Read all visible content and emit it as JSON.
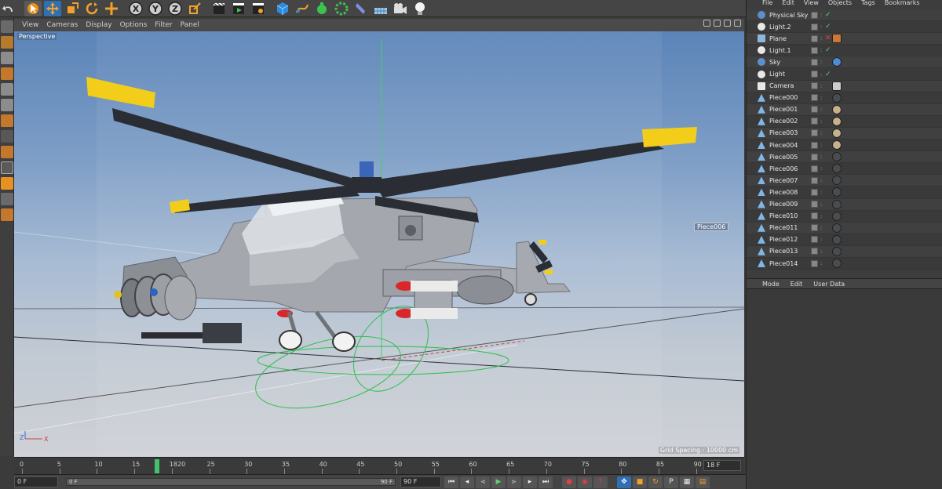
{
  "toolbar": {
    "axis_x": "X",
    "axis_y": "Y",
    "axis_z": "Z"
  },
  "viewport": {
    "menu": [
      "View",
      "Cameras",
      "Display",
      "Options",
      "Filter",
      "Panel"
    ],
    "camera_label": "Perspective",
    "selected_tag": "Piece006",
    "grid_spacing": "Grid Spacing : 10000 cm",
    "axis_z": "Z",
    "axis_x": "X"
  },
  "timeline": {
    "ticks": [
      "0",
      "5",
      "10",
      "15",
      "1820",
      "25",
      "30",
      "35",
      "40",
      "45",
      "50",
      "55",
      "60",
      "65",
      "70",
      "75",
      "80",
      "85",
      "90"
    ],
    "current_frame": 18,
    "end_frame_field": "18 F"
  },
  "bottombar": {
    "start_field": "0 F",
    "range_start": "0 F",
    "range_end": "90 F",
    "end_field": "90 F"
  },
  "object_manager": {
    "menu": [
      "File",
      "Edit",
      "View",
      "Objects",
      "Tags",
      "Bookmarks"
    ],
    "objects": [
      {
        "name": "Physical Sky",
        "icon": "sky-icon",
        "check": "✓",
        "tag": "none"
      },
      {
        "name": "Light.2",
        "icon": "area-light-icon",
        "check": "✓",
        "tag": "none"
      },
      {
        "name": "Plane",
        "icon": "plane-icon",
        "check": "✕",
        "tag": "texture"
      },
      {
        "name": "Light.1",
        "icon": "spot-light-icon",
        "check": "✓",
        "tag": "none"
      },
      {
        "name": "Sky",
        "icon": "sky-icon",
        "check": "",
        "tag": "sky"
      },
      {
        "name": "Light",
        "icon": "light-icon",
        "check": "✓",
        "tag": "none"
      },
      {
        "name": "Camera",
        "icon": "camera-icon",
        "check": "",
        "tag": "target"
      },
      {
        "name": "Piece000",
        "icon": "polygon-icon",
        "check": "",
        "tag": "dark"
      },
      {
        "name": "Piece001",
        "icon": "polygon-icon",
        "check": "",
        "tag": "tan"
      },
      {
        "name": "Piece002",
        "icon": "polygon-icon",
        "check": "",
        "tag": "tan"
      },
      {
        "name": "Piece003",
        "icon": "polygon-icon",
        "check": "",
        "tag": "tan"
      },
      {
        "name": "Piece004",
        "icon": "polygon-icon",
        "check": "",
        "tag": "tan"
      },
      {
        "name": "Piece005",
        "icon": "polygon-icon",
        "check": "",
        "tag": "dark"
      },
      {
        "name": "Piece006",
        "icon": "polygon-icon",
        "check": "",
        "tag": "dark"
      },
      {
        "name": "Piece007",
        "icon": "polygon-icon",
        "check": "",
        "tag": "dark"
      },
      {
        "name": "Piece008",
        "icon": "polygon-icon",
        "check": "",
        "tag": "dark"
      },
      {
        "name": "Piece009",
        "icon": "polygon-icon",
        "check": "",
        "tag": "dark"
      },
      {
        "name": "Piece010",
        "icon": "polygon-icon",
        "check": "",
        "tag": "dark"
      },
      {
        "name": "Piece011",
        "icon": "polygon-icon",
        "check": "",
        "tag": "dark"
      },
      {
        "name": "Piece012",
        "icon": "polygon-icon",
        "check": "",
        "tag": "dark"
      },
      {
        "name": "Piece013",
        "icon": "polygon-icon",
        "check": "",
        "tag": "dark"
      },
      {
        "name": "Piece014",
        "icon": "polygon-icon",
        "check": "",
        "tag": "dark"
      }
    ]
  },
  "attribute_manager": {
    "menu": [
      "Mode",
      "Edit",
      "User Data"
    ]
  },
  "colors": {
    "accent_orange": "#f2a12b",
    "selection_blue": "#2f6fb3",
    "timeline_cursor": "#42c36b",
    "rotor_black": "#2a2d33",
    "rotor_tip_yellow": "#f2cd1a",
    "body_gray": "#a9adb3"
  }
}
